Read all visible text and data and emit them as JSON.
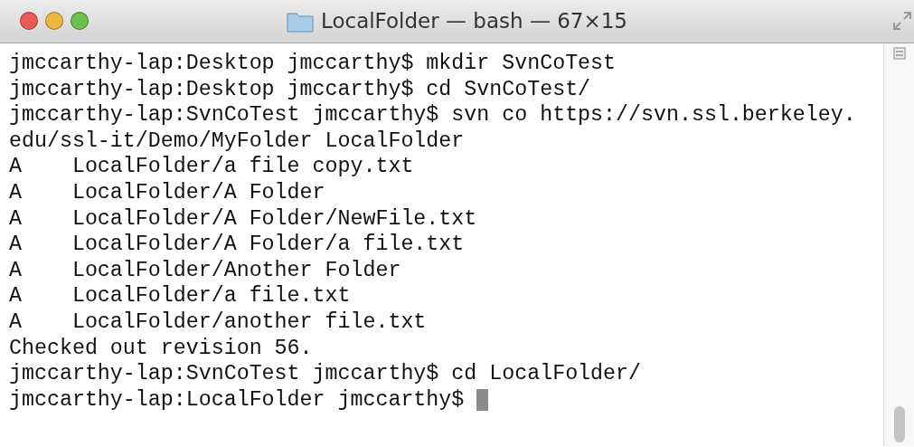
{
  "window": {
    "title": "LocalFolder — bash — 67×15"
  },
  "terminal": {
    "lines": [
      "jmccarthy-lap:Desktop jmccarthy$ mkdir SvnCoTest",
      "jmccarthy-lap:Desktop jmccarthy$ cd SvnCoTest/",
      "jmccarthy-lap:SvnCoTest jmccarthy$ svn co https://svn.ssl.berkeley.",
      "edu/ssl-it/Demo/MyFolder LocalFolder",
      "A    LocalFolder/a file copy.txt",
      "A    LocalFolder/A Folder",
      "A    LocalFolder/A Folder/NewFile.txt",
      "A    LocalFolder/A Folder/a file.txt",
      "A    LocalFolder/Another Folder",
      "A    LocalFolder/a file.txt",
      "A    LocalFolder/another file.txt",
      "Checked out revision 56.",
      "jmccarthy-lap:SvnCoTest jmccarthy$ cd LocalFolder/",
      "jmccarthy-lap:LocalFolder jmccarthy$ "
    ]
  }
}
